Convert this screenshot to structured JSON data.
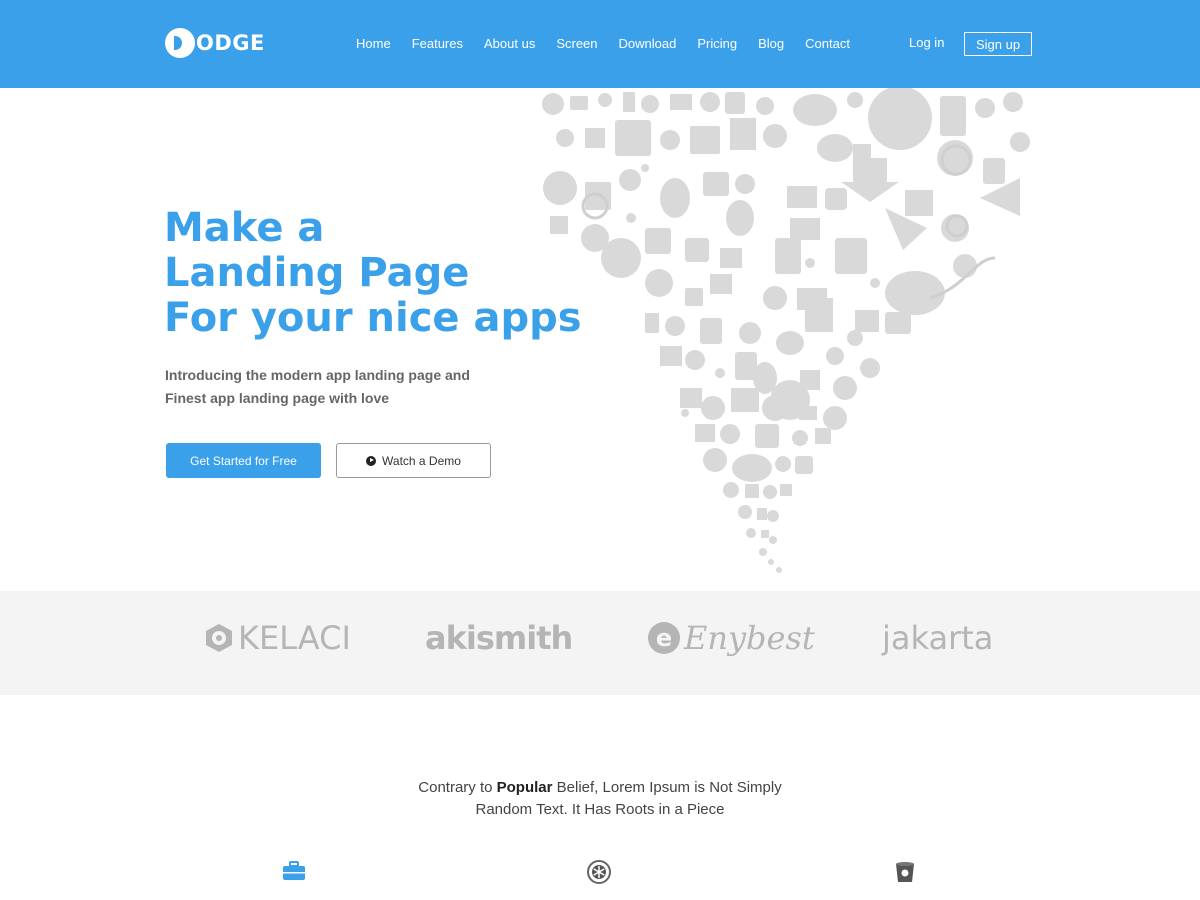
{
  "header": {
    "logo_text": "ODGE",
    "nav": [
      "Home",
      "Features",
      "About us",
      "Screen",
      "Download",
      "Pricing",
      "Blog",
      "Contact"
    ],
    "login": "Log in",
    "signup": "Sign up"
  },
  "hero": {
    "title_lines": [
      "Make a",
      "Landing Page",
      "For your nice apps"
    ],
    "subtitle_lines": [
      "Introducing the modern app landing page and",
      "Finest app landing page with love"
    ],
    "primary_button": "Get Started for Free",
    "secondary_button": "Watch a Demo"
  },
  "brands": [
    "KELACI",
    "akismith",
    "Enybest",
    "jakarta"
  ],
  "section": {
    "line1_before": "Contrary to ",
    "line1_bold": "Popular",
    "line1_after": " Belief, Lorem Ipsum is Not Simply",
    "line2": "Random Text. It Has Roots in a Piece"
  },
  "feature_icons": [
    "briefcase-icon",
    "asterisk-badge-icon",
    "bucket-icon"
  ],
  "colors": {
    "accent": "#3aa0ea",
    "logo_gray": "#b5b5b5",
    "strip_bg": "#f4f4f4"
  }
}
